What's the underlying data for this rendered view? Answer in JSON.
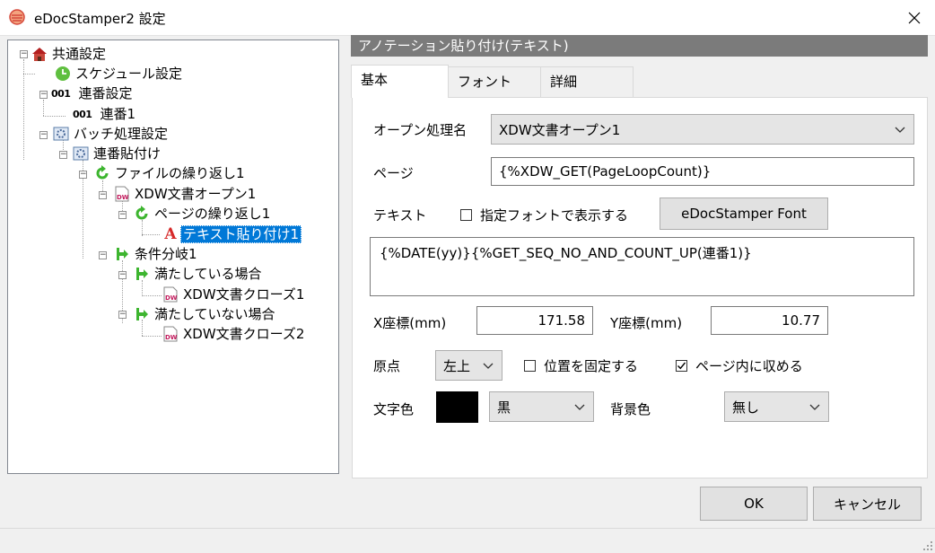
{
  "window": {
    "title": "eDocStamper2 設定"
  },
  "tree": {
    "items": [
      {
        "label": "共通設定"
      },
      {
        "label": "スケジュール設定"
      },
      {
        "label": "連番設定",
        "icon_text": "001"
      },
      {
        "label": "連番1",
        "icon_text": "001"
      },
      {
        "label": "バッチ処理設定"
      },
      {
        "label": "連番貼付け"
      },
      {
        "label": "ファイルの繰り返し1"
      },
      {
        "label": "XDW文書オープン1",
        "icon_text": "DW"
      },
      {
        "label": "ページの繰り返し1"
      },
      {
        "label": "テキスト貼り付け1",
        "icon_text": "A"
      },
      {
        "label": "条件分岐1"
      },
      {
        "label": "満たしている場合"
      },
      {
        "label": "XDW文書クローズ1",
        "icon_text": "DW"
      },
      {
        "label": "満たしていない場合"
      },
      {
        "label": "XDW文書クローズ2",
        "icon_text": "DW"
      }
    ],
    "expander_minus": "−"
  },
  "panel": {
    "title": "アノテーション貼り付け(テキスト)"
  },
  "tabs": [
    {
      "label": "基本"
    },
    {
      "label": "フォント"
    },
    {
      "label": "詳細"
    }
  ],
  "form": {
    "open_process_label": "オープン処理名",
    "open_process_value": "XDW文書オープン1",
    "page_label": "ページ",
    "page_value": "{%XDW_GET(PageLoopCount)}",
    "text_label": "テキスト",
    "font_checkbox_label": "指定フォントで表示する",
    "font_button_label": "eDocStamper Font",
    "text_value": "{%DATE(yy)}{%GET_SEQ_NO_AND_COUNT_UP(連番1)}",
    "x_label": "X座標(mm)",
    "x_value": "171.58",
    "y_label": "Y座標(mm)",
    "y_value": "10.77",
    "origin_label": "原点",
    "origin_value": "左上",
    "fix_position_label": "位置を固定する",
    "fit_page_label": "ページ内に収める",
    "text_color_label": "文字色",
    "text_color_value": "黒",
    "text_color_hex": "#000000",
    "bg_color_label": "背景色",
    "bg_color_value": "無し"
  },
  "buttons": {
    "ok": "OK",
    "cancel": "キャンセル"
  }
}
